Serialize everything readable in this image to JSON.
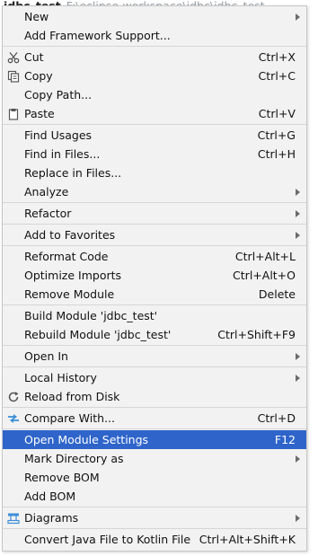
{
  "background": {
    "project": "jdbc_test",
    "path": "F:\\eclipse-workspace\\jdbc\\jdbc_test"
  },
  "menu": {
    "groups": [
      [
        {
          "label": "New",
          "shortcut": "",
          "submenu": true
        },
        {
          "label": "Add Framework Support...",
          "shortcut": "",
          "submenu": false
        }
      ],
      [
        {
          "label": "Cut",
          "shortcut": "Ctrl+X",
          "submenu": false,
          "icon": "scissors-icon"
        },
        {
          "label": "Copy",
          "shortcut": "Ctrl+C",
          "submenu": false,
          "icon": "copy-icon"
        },
        {
          "label": "Copy Path...",
          "shortcut": "",
          "submenu": false
        },
        {
          "label": "Paste",
          "shortcut": "Ctrl+V",
          "submenu": false,
          "icon": "clipboard-icon"
        }
      ],
      [
        {
          "label": "Find Usages",
          "shortcut": "Ctrl+G",
          "submenu": false
        },
        {
          "label": "Find in Files...",
          "shortcut": "Ctrl+H",
          "submenu": false
        },
        {
          "label": "Replace in Files...",
          "shortcut": "",
          "submenu": false
        },
        {
          "label": "Analyze",
          "shortcut": "",
          "submenu": true
        }
      ],
      [
        {
          "label": "Refactor",
          "shortcut": "",
          "submenu": true
        }
      ],
      [
        {
          "label": "Add to Favorites",
          "shortcut": "",
          "submenu": true
        }
      ],
      [
        {
          "label": "Reformat Code",
          "shortcut": "Ctrl+Alt+L",
          "submenu": false
        },
        {
          "label": "Optimize Imports",
          "shortcut": "Ctrl+Alt+O",
          "submenu": false
        },
        {
          "label": "Remove Module",
          "shortcut": "Delete",
          "submenu": false
        }
      ],
      [
        {
          "label": "Build Module 'jdbc_test'",
          "shortcut": "",
          "submenu": false
        },
        {
          "label": "Rebuild Module 'jdbc_test'",
          "shortcut": "Ctrl+Shift+F9",
          "submenu": false
        }
      ],
      [
        {
          "label": "Open In",
          "shortcut": "",
          "submenu": true
        }
      ],
      [
        {
          "label": "Local History",
          "shortcut": "",
          "submenu": true
        },
        {
          "label": "Reload from Disk",
          "shortcut": "",
          "submenu": false,
          "icon": "reload-icon"
        }
      ],
      [
        {
          "label": "Compare With...",
          "shortcut": "Ctrl+D",
          "submenu": false,
          "icon": "compare-icon"
        }
      ],
      [
        {
          "label": "Open Module Settings",
          "shortcut": "F12",
          "submenu": false,
          "selected": true
        },
        {
          "label": "Mark Directory as",
          "shortcut": "",
          "submenu": true
        },
        {
          "label": "Remove BOM",
          "shortcut": "",
          "submenu": false
        },
        {
          "label": "Add BOM",
          "shortcut": "",
          "submenu": false
        }
      ],
      [
        {
          "label": "Diagrams",
          "shortcut": "",
          "submenu": true,
          "icon": "diagram-icon"
        }
      ],
      [
        {
          "label": "Convert Java File to Kotlin File",
          "shortcut": "Ctrl+Alt+Shift+K",
          "submenu": false
        }
      ]
    ]
  }
}
